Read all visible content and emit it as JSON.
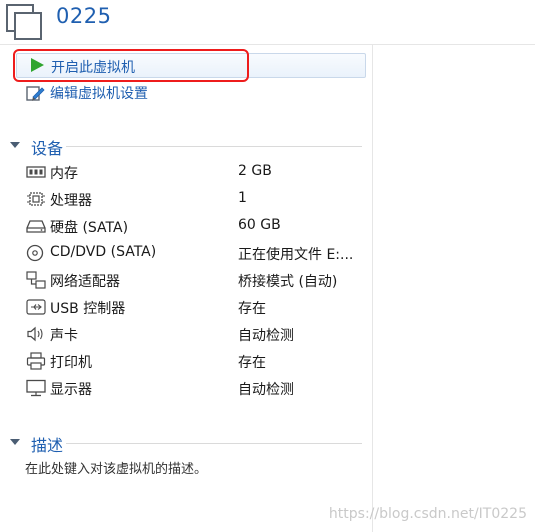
{
  "header": {
    "title": "0225",
    "icon": "vm-windows-icon"
  },
  "actions": {
    "start_label": "开启此虚拟机",
    "start_icon": "play-icon",
    "edit_label": "编辑虚拟机设置",
    "edit_icon": "edit-settings-icon",
    "highlight_color": "#ee1c1c"
  },
  "devices_section": {
    "title": "设备",
    "items": [
      {
        "name": "内存",
        "value": "2 GB",
        "icon": "memory-icon"
      },
      {
        "name": "处理器",
        "value": "1",
        "icon": "processor-icon"
      },
      {
        "name": "硬盘 (SATA)",
        "value": "60 GB",
        "icon": "hard-disk-icon"
      },
      {
        "name": "CD/DVD (SATA)",
        "value": "正在使用文件 E:...",
        "icon": "cd-dvd-icon"
      },
      {
        "name": "网络适配器",
        "value": "桥接模式 (自动)",
        "icon": "network-adapter-icon"
      },
      {
        "name": "USB 控制器",
        "value": "存在",
        "icon": "usb-icon"
      },
      {
        "name": "声卡",
        "value": "自动检测",
        "icon": "sound-card-icon"
      },
      {
        "name": "打印机",
        "value": "存在",
        "icon": "printer-icon"
      },
      {
        "name": "显示器",
        "value": "自动检测",
        "icon": "display-icon"
      }
    ]
  },
  "description_section": {
    "title": "描述",
    "placeholder": "在此处键入对该虚拟机的描述。"
  },
  "watermark": "https://blog.csdn.net/IT0225",
  "colors": {
    "accent": "#1f5fb0",
    "play_green": "#2fa52f"
  }
}
